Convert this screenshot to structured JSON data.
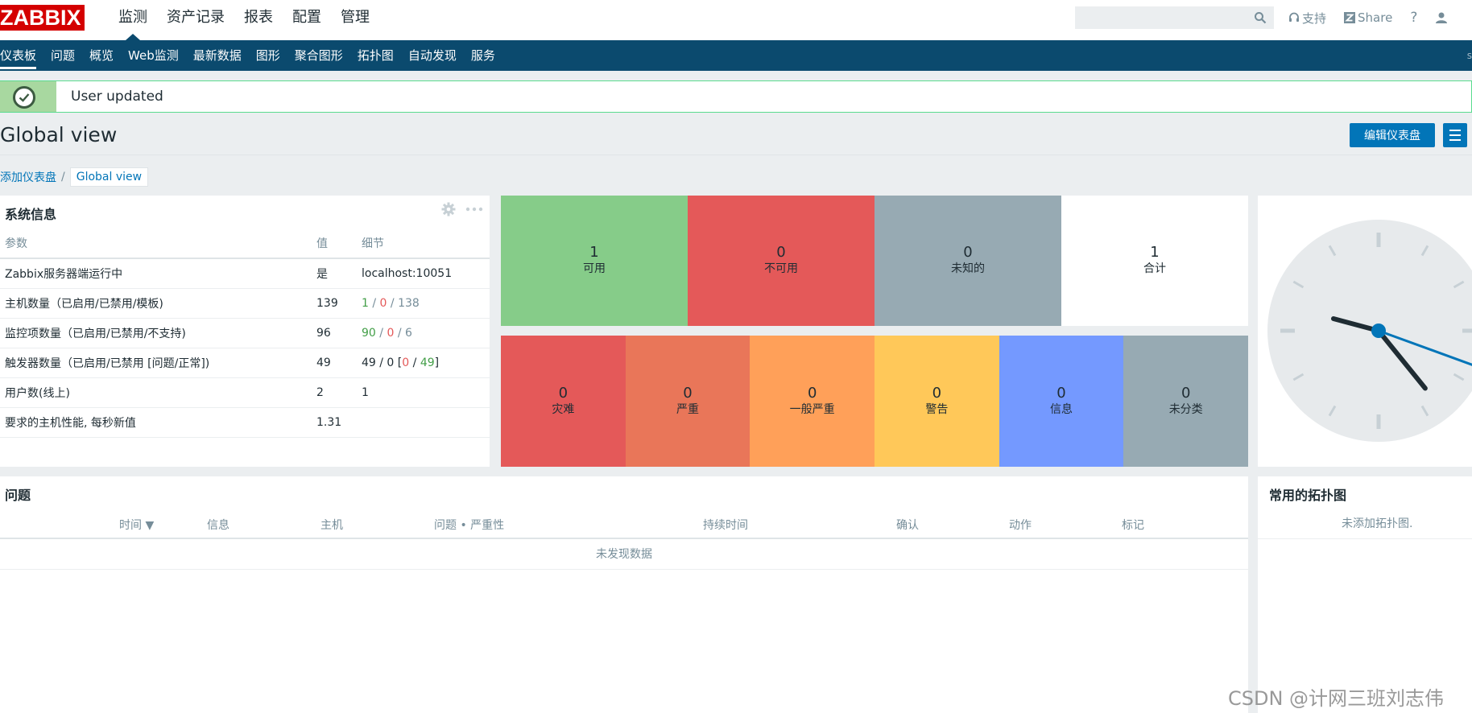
{
  "app": {
    "logo": "ZABBIX",
    "main_menu": [
      "监测",
      "资产记录",
      "报表",
      "配置",
      "管理"
    ],
    "main_menu_active": 0,
    "search": {
      "placeholder": "",
      "icon": "search-icon"
    },
    "top_links": {
      "support": "支持",
      "share": "Share",
      "help": "?"
    }
  },
  "submenu": {
    "items": [
      "仪表板",
      "问题",
      "概览",
      "Web监测",
      "最新数据",
      "图形",
      "聚合图形",
      "拓扑图",
      "自动发现",
      "服务"
    ],
    "active": 0,
    "edge_text": "s"
  },
  "message": {
    "text": "User updated",
    "type": "success"
  },
  "page": {
    "title": "Global view",
    "edit_button": "编辑仪表盘",
    "breadcrumb": {
      "parent": "添加仪表盘",
      "separator": "/",
      "current": "Global view"
    }
  },
  "system_info": {
    "title": "系统信息",
    "headers": {
      "param": "参数",
      "value": "值",
      "details": "细节"
    },
    "rows": [
      {
        "param": "Zabbix服务器端运行中",
        "value": "是",
        "details": "localhost:10051"
      },
      {
        "param": "主机数量（已启用/已禁用/模板)",
        "value": "139",
        "d1": "1",
        "s1": " / ",
        "d2": "0",
        "s2": " / ",
        "d3": "138"
      },
      {
        "param": "监控项数量（已启用/已禁用/不支持)",
        "value": "96",
        "d1": "90",
        "s1": " / ",
        "d2": "0",
        "s2": " / ",
        "d3": "6"
      },
      {
        "param": "触发器数量（已启用/已禁用 [问题/正常])",
        "value": "49",
        "d1": "49 / 0 [",
        "d2": "0",
        "s2": " / ",
        "d3": "49",
        "s3": "]"
      },
      {
        "param": "用户数(线上)",
        "value": "2",
        "d1": "1"
      },
      {
        "param": "要求的主机性能, 每秒新值",
        "value": "1.31",
        "details": ""
      }
    ]
  },
  "host_availability": {
    "cells": [
      {
        "num": "1",
        "label": "可用",
        "color": "#86cc89"
      },
      {
        "num": "0",
        "label": "不可用",
        "color": "#e45959"
      },
      {
        "num": "0",
        "label": "未知的",
        "color": "#97aab3"
      },
      {
        "num": "1",
        "label": "合计",
        "color": "#ffffff"
      }
    ]
  },
  "problems_by_severity": {
    "cells": [
      {
        "num": "0",
        "label": "灾难",
        "color": "#e45959"
      },
      {
        "num": "0",
        "label": "严重",
        "color": "#e97659"
      },
      {
        "num": "0",
        "label": "一般严重",
        "color": "#ffa059"
      },
      {
        "num": "0",
        "label": "警告",
        "color": "#ffc859"
      },
      {
        "num": "0",
        "label": "信息",
        "color": "#7499ff"
      },
      {
        "num": "0",
        "label": "未分类",
        "color": "#97aab3"
      }
    ]
  },
  "clock": {
    "hour": 9,
    "minute": 23,
    "second": 17
  },
  "problems": {
    "title": "问题",
    "headers": [
      "时间 ▼",
      "信息",
      "主机",
      "问题 • 严重性",
      "持续时间",
      "确认",
      "动作",
      "标记"
    ],
    "no_data": "未发现数据"
  },
  "favorite_maps": {
    "title": "常用的拓扑图",
    "no_data": "未添加拓扑图."
  },
  "watermark": "CSDN @计网三班刘志伟",
  "colors": {
    "header_dark": "#0b4a6e",
    "accent": "#0275b8",
    "logo_red": "#d40000",
    "success": "#59db8f"
  }
}
